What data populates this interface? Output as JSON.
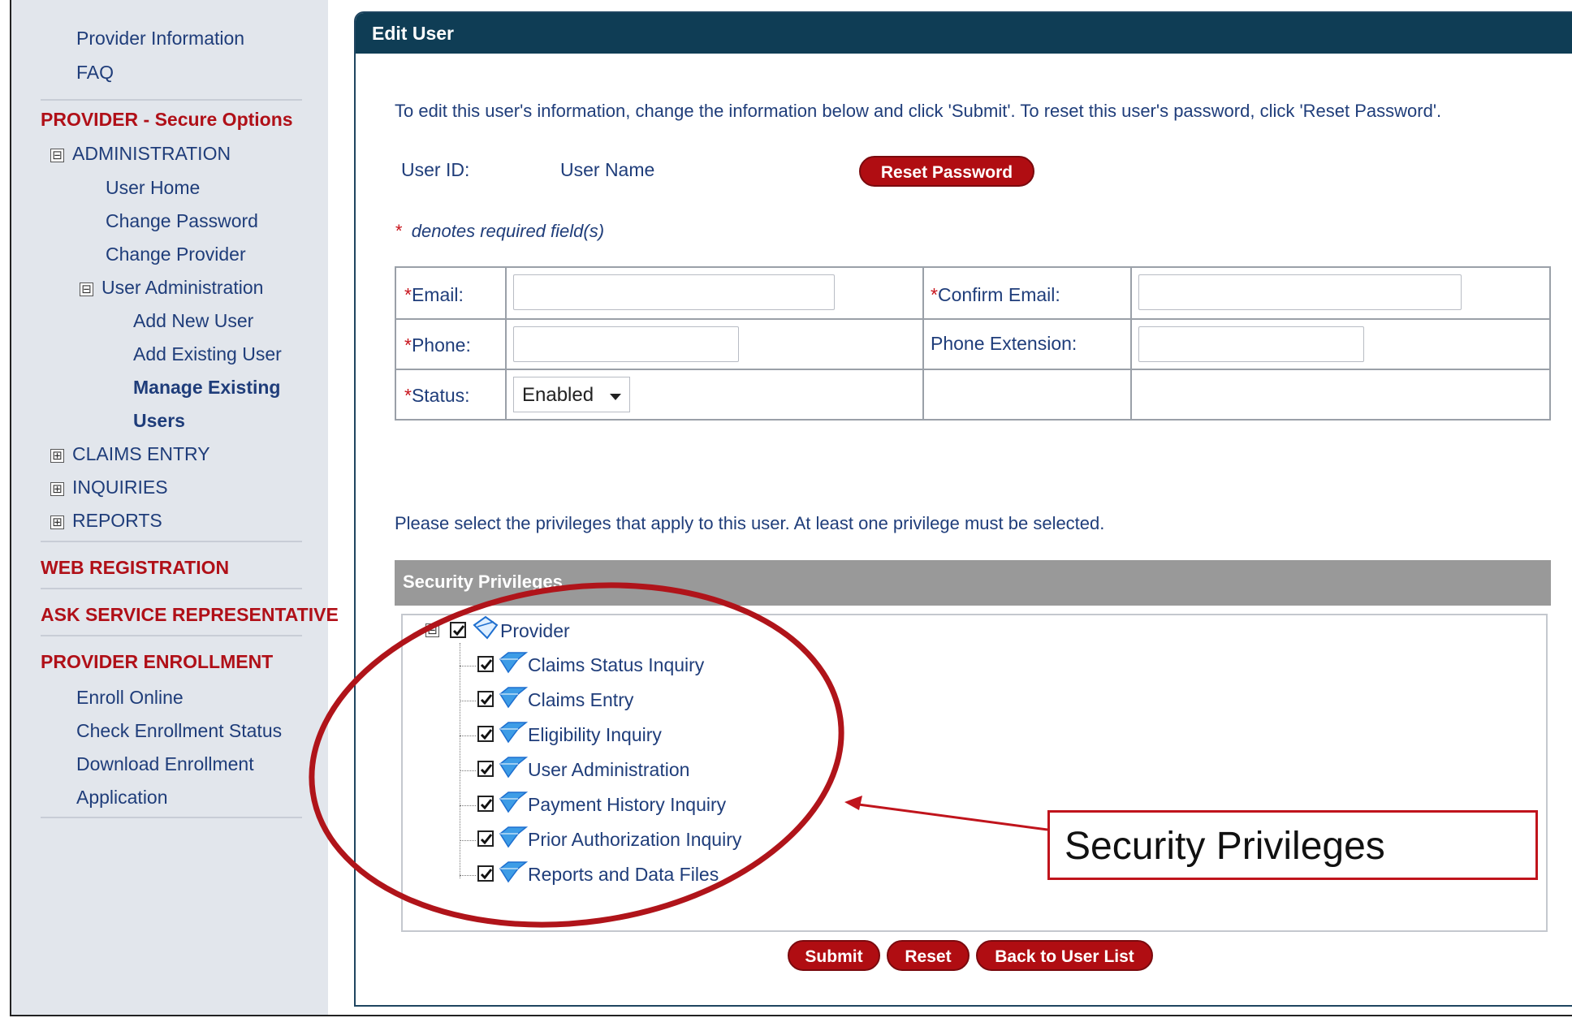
{
  "sidebar": {
    "top_items": [
      "Provider Information",
      "FAQ"
    ],
    "secure_heading": "PROVIDER - Secure Options",
    "admin_label": "ADMINISTRATION",
    "admin_children": [
      "User Home",
      "Change Password",
      "Change Provider"
    ],
    "user_admin_label": "User Administration",
    "user_admin_children": [
      "Add New User",
      "Add Existing User"
    ],
    "manage_existing_line1": "Manage Existing",
    "manage_existing_line2": "Users",
    "collapsed_sections": [
      "CLAIMS ENTRY",
      "INQUIRIES",
      "REPORTS"
    ],
    "web_registration": "WEB REGISTRATION",
    "ask_service": "ASK SERVICE REPRESENTATIVE",
    "enrollment_heading": "PROVIDER ENROLLMENT",
    "enrollment_items": [
      "Enroll Online",
      "Check Enrollment Status",
      "Download Enrollment",
      "Application"
    ],
    "expanded_glyph": "⊟",
    "collapsed_glyph": "⊞"
  },
  "panel": {
    "title": "Edit User",
    "instructions": "To edit this user's information, change the information below and click 'Submit'. To reset this user's password, click 'Reset Password'.",
    "user_id_label": "User ID:",
    "user_name_label": "User Name",
    "reset_password_label": "Reset Password",
    "required_star": "*",
    "required_note": "denotes required field(s)"
  },
  "form": {
    "email_label": "Email:",
    "confirm_email_label": "Confirm Email:",
    "phone_label": "Phone:",
    "phone_ext_label": "Phone Extension:",
    "status_label": "Status:",
    "status_value": "Enabled",
    "email_value": "",
    "confirm_email_value": "",
    "phone_value": "",
    "phone_ext_value": ""
  },
  "privileges": {
    "instruction": "Please select the privileges that apply to this user. At least one privilege must be selected.",
    "header": "Security Privileges",
    "root_label": "Provider",
    "items": [
      "Claims Status Inquiry",
      "Claims Entry",
      "Eligibility Inquiry",
      "User Administration",
      "Payment History Inquiry",
      "Prior Authorization Inquiry",
      "Reports and Data Files"
    ]
  },
  "actions": {
    "submit": "Submit",
    "reset": "Reset",
    "back": "Back to User List"
  },
  "annotation": {
    "callout_text": "Security  Privileges",
    "color": "#c0141c"
  },
  "colors": {
    "header_bg": "#0f3d55",
    "button_bg": "#b00d12",
    "sidebar_bg": "#e2e6ec",
    "heading_red": "#b01018",
    "link_blue": "#1f3d7a"
  }
}
